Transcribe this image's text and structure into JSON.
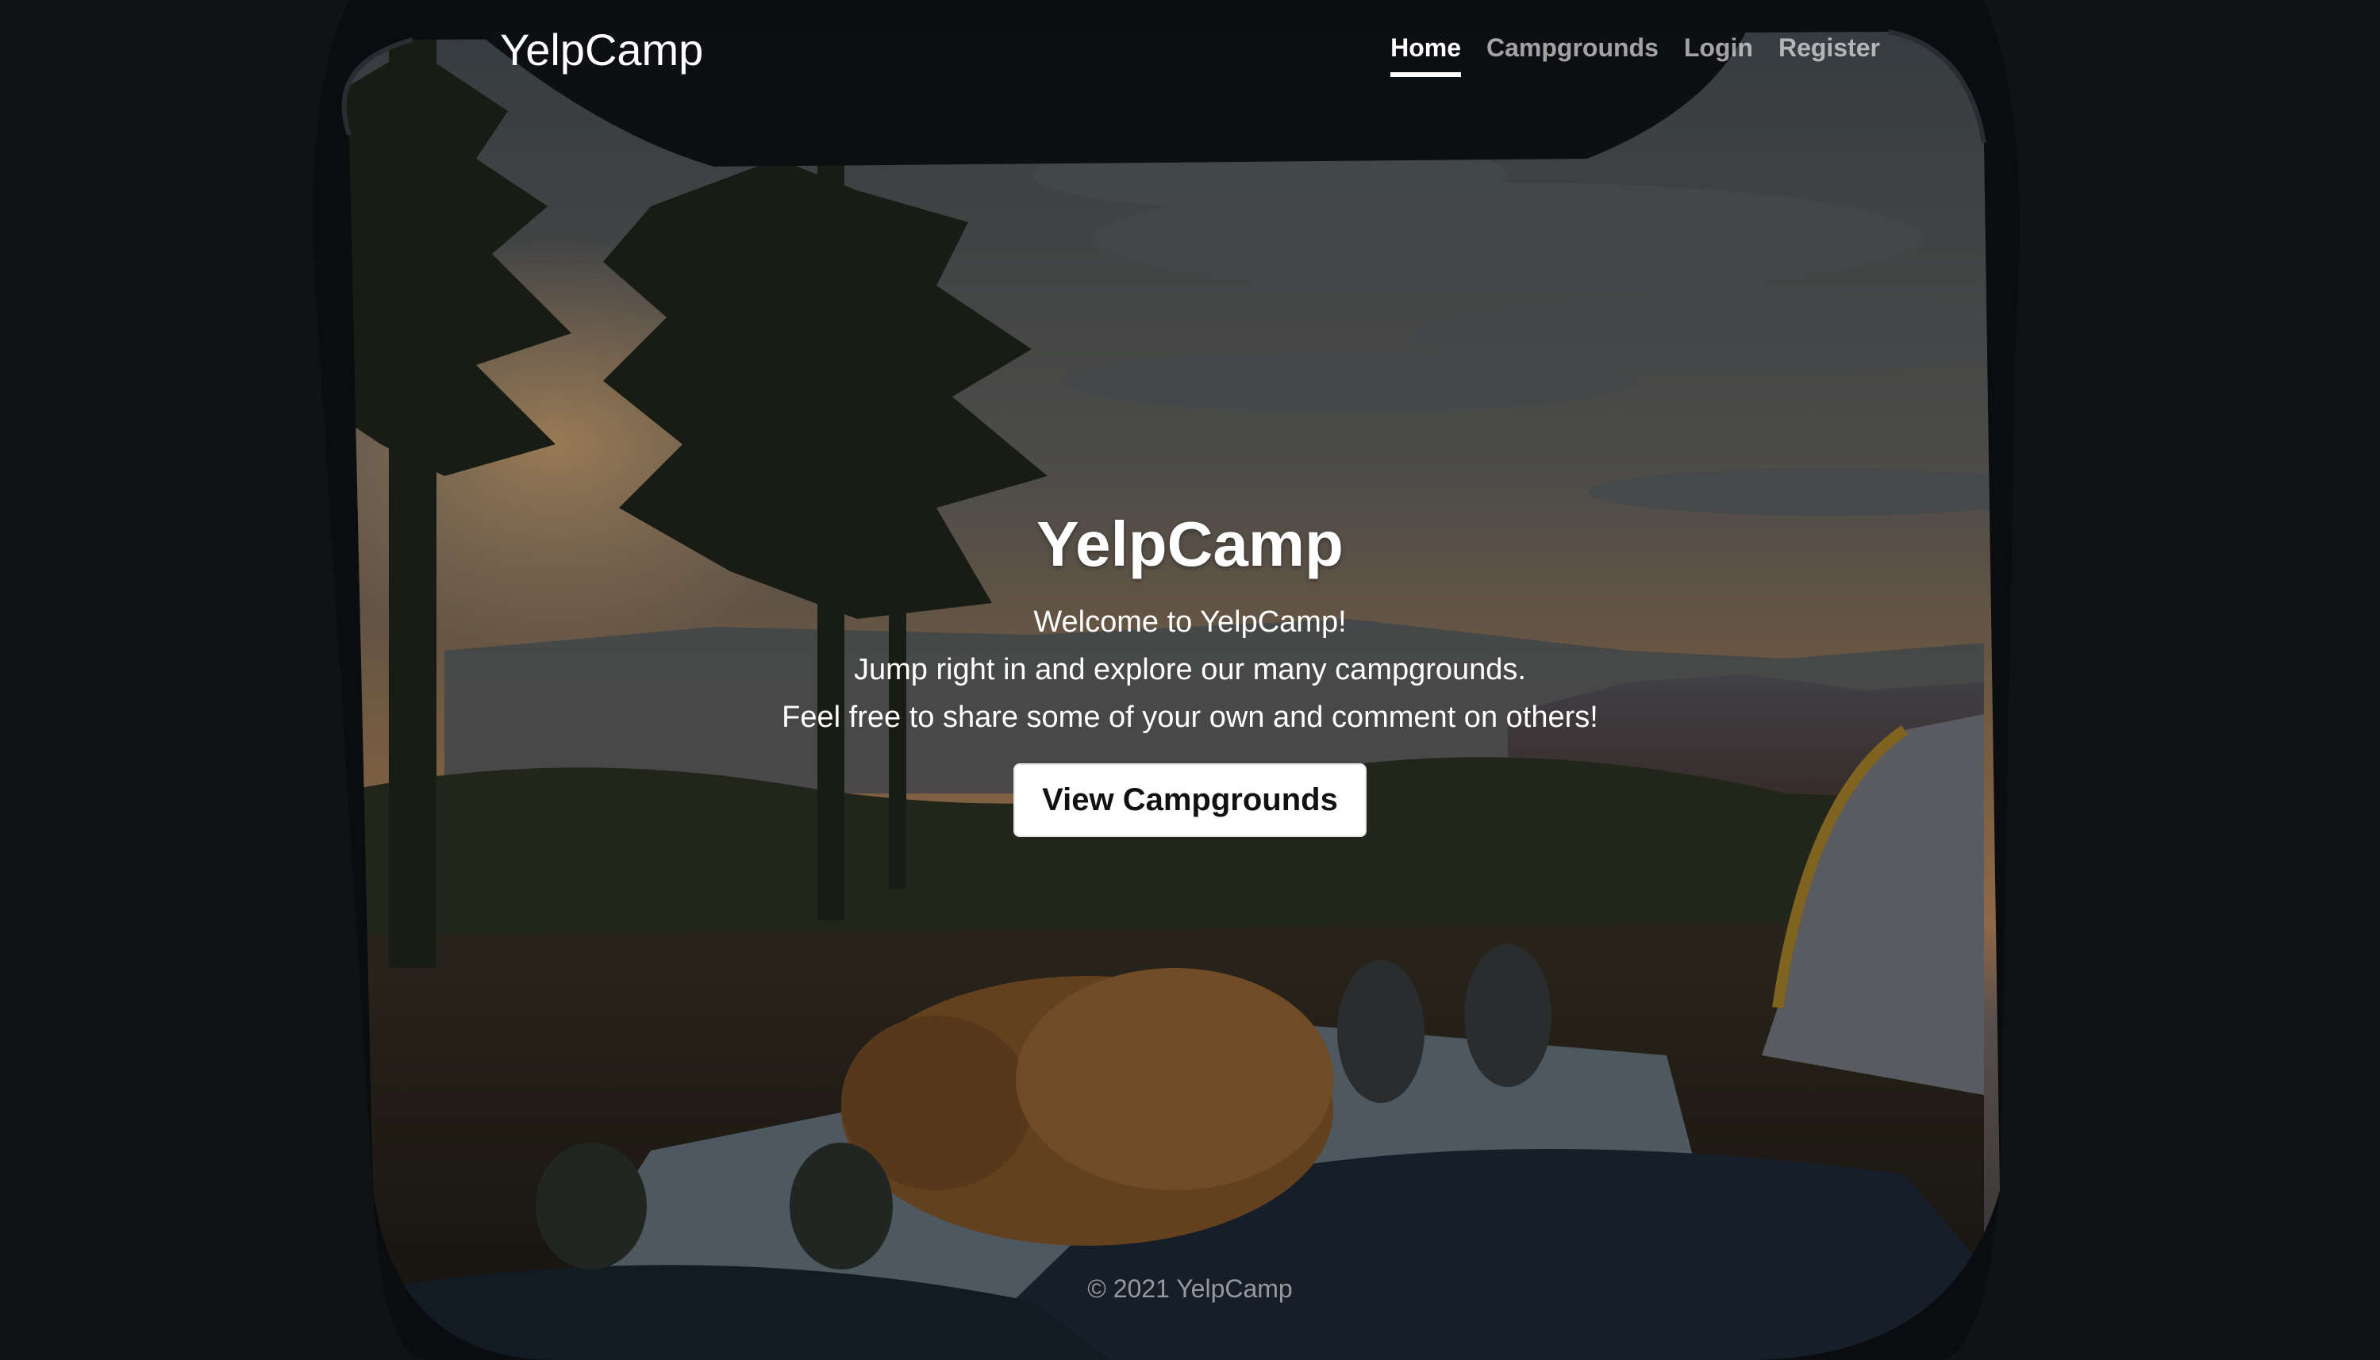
{
  "navbar": {
    "brand": "YelpCamp",
    "links": [
      {
        "label": "Home",
        "active": true
      },
      {
        "label": "Campgrounds",
        "active": false
      },
      {
        "label": "Login",
        "active": false
      },
      {
        "label": "Register",
        "active": false
      }
    ]
  },
  "hero": {
    "title": "YelpCamp",
    "lines": [
      "Welcome to YelpCamp!",
      "Jump right in and explore our many campgrounds.",
      "Feel free to share some of your own and comment on others!"
    ],
    "button_label": "View Campgrounds"
  },
  "footer": {
    "text": "© 2021 YelpCamp"
  },
  "colors": {
    "text": "#ffffff",
    "button_bg": "#ffffff",
    "button_text": "#111111",
    "inactive_link": "#9e9e9e"
  }
}
